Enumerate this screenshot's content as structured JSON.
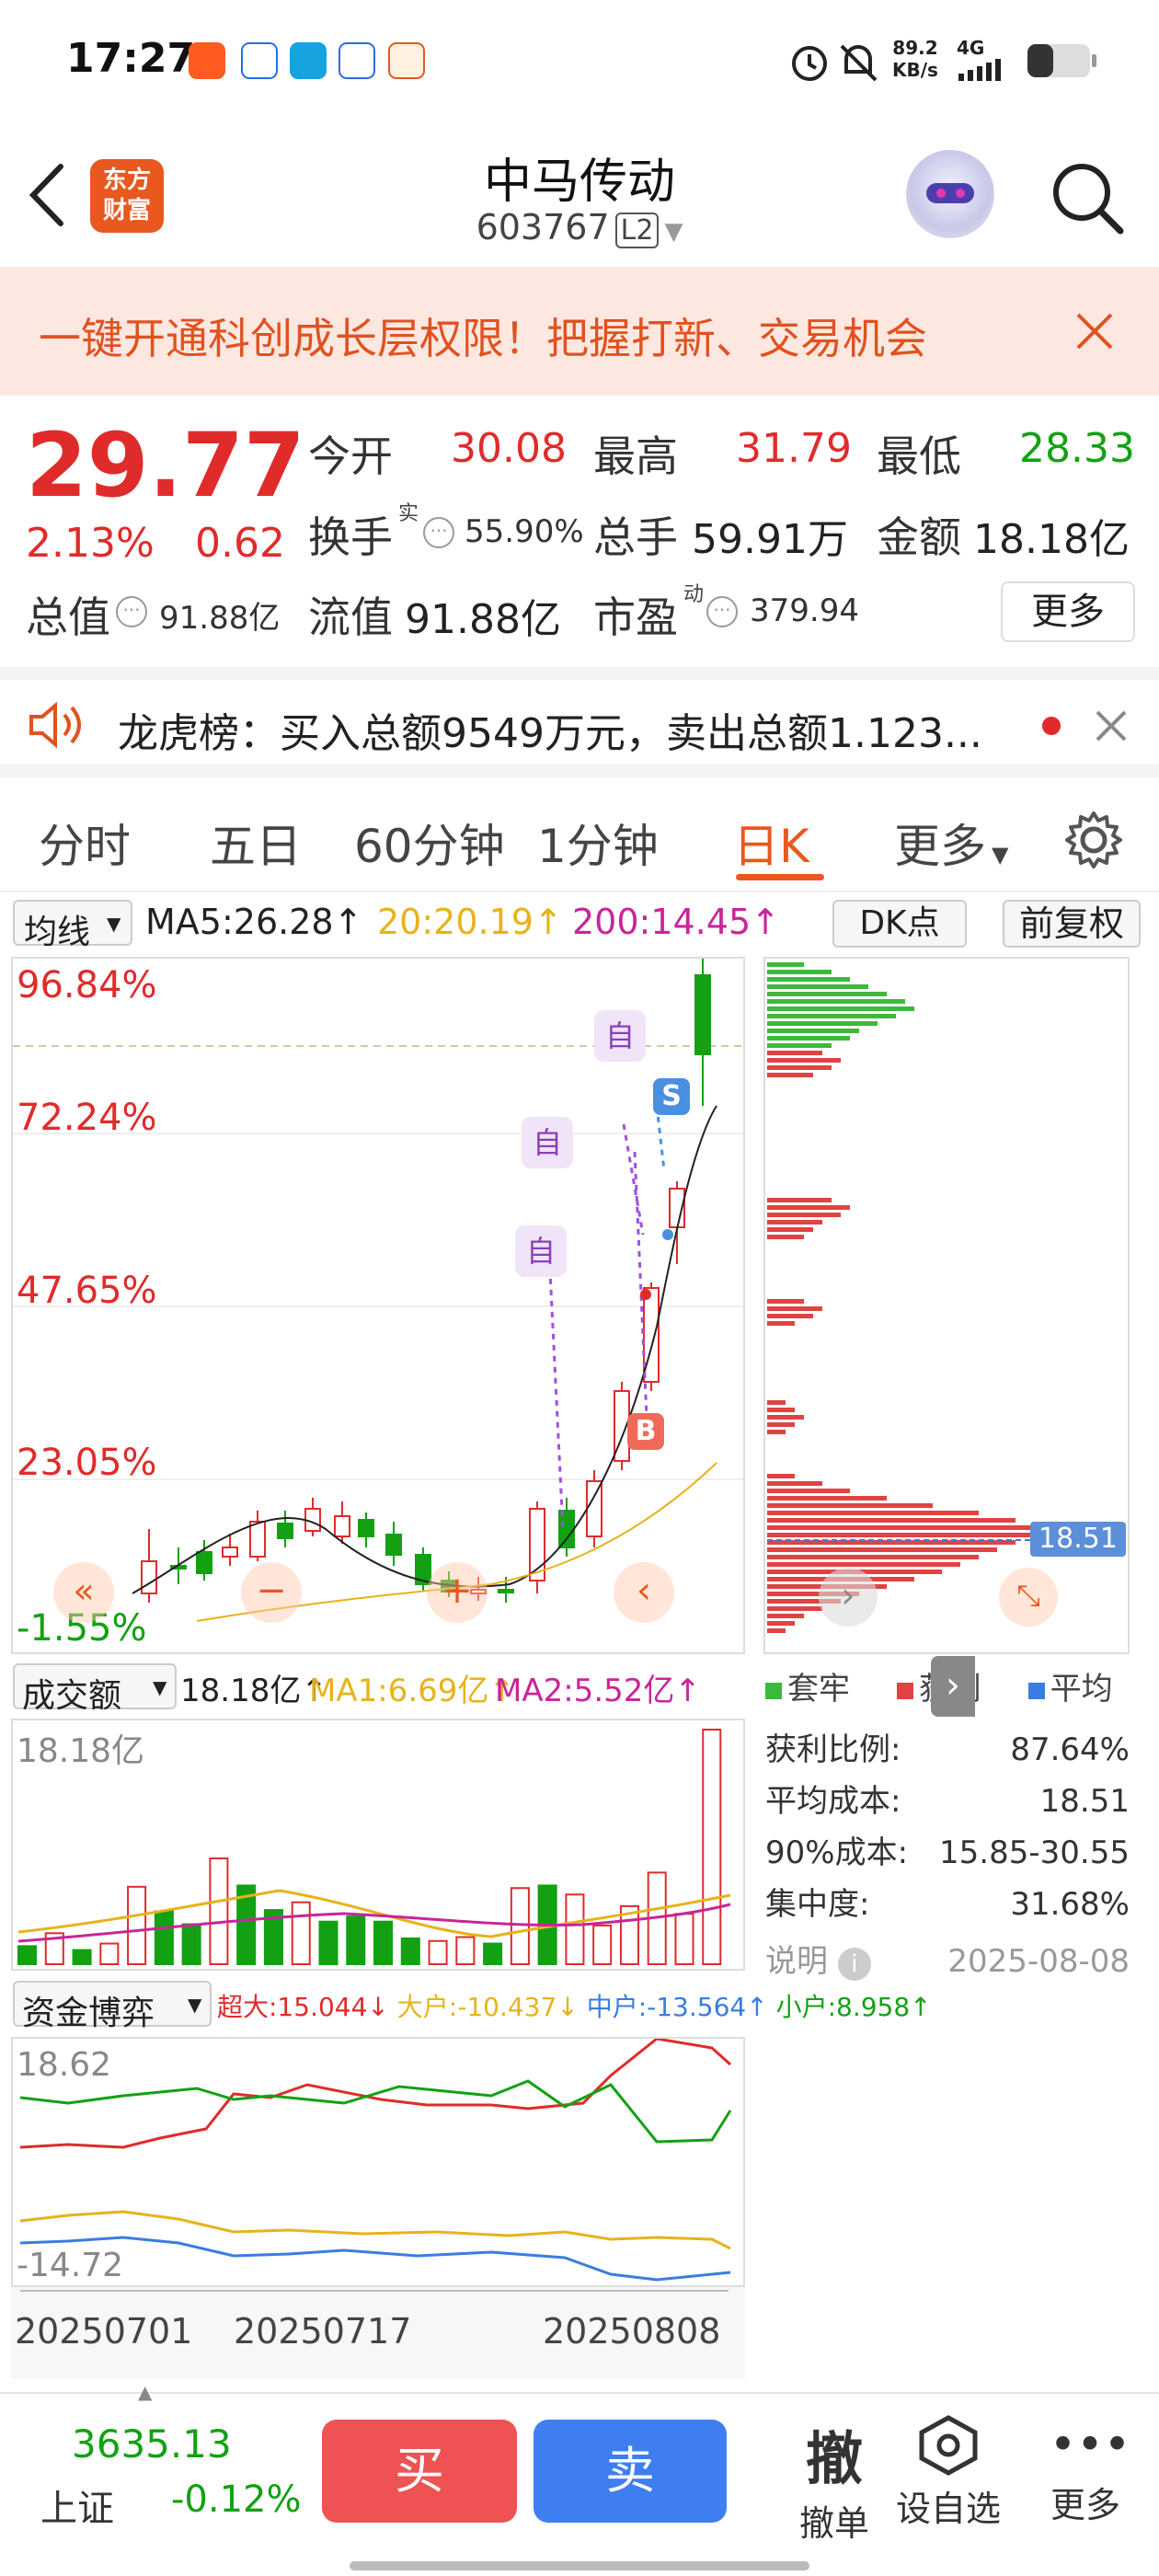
{
  "status_bar": {
    "time": "17:27",
    "net_speed_value": "89.2",
    "net_speed_unit": "KB/s",
    "network": "4G",
    "icons": [
      "app-icon-1",
      "app-icon-2",
      "app-icon-3",
      "app-icon-4",
      "app-icon-5",
      "alarm-icon",
      "mute-icon",
      "signal-icon",
      "battery-icon"
    ]
  },
  "header": {
    "logo_line1": "东方",
    "logo_line2": "财富",
    "stock_name": "中马传动",
    "stock_code": "603767",
    "level_badge": "L2"
  },
  "banner": {
    "text": "一键开通科创成长层权限！把握打新、交易机会"
  },
  "quote": {
    "price": "29.77",
    "change_pct": "2.13%",
    "change": "0.62",
    "open_label": "今开",
    "open": "30.08",
    "high_label": "最高",
    "high": "31.79",
    "low_label": "最低",
    "low": "28.33",
    "turnover_label": "换手",
    "turnover_sup": "实",
    "turnover": "55.90%",
    "volume_label": "总手",
    "volume": "59.91万",
    "amount_label": "金额",
    "amount": "18.18亿",
    "mktcap_label": "总值",
    "mktcap": "91.88亿",
    "float_label": "流值",
    "float": "91.88亿",
    "pe_label": "市盈",
    "pe_sup": "动",
    "pe": "379.94",
    "more_button": "更多"
  },
  "lhb": {
    "text": "龙虎榜：买入总额9549万元，卖出总额1.123..."
  },
  "tabs": {
    "items": [
      "分时",
      "五日",
      "60分钟",
      "1分钟",
      "日K",
      "更多"
    ],
    "active_index": 4
  },
  "kline": {
    "ma_selector": "均线",
    "ma5": "MA5:26.28",
    "ma20": "20:20.19",
    "ma200": "200:14.45",
    "dk_button": "DK点",
    "adjust_button": "前复权",
    "y_labels": [
      "96.84%",
      "72.24%",
      "47.65%",
      "23.05%",
      "-1.55%"
    ],
    "markers": [
      "自",
      "自",
      "自",
      "S",
      "B"
    ],
    "cost_label": "18.51"
  },
  "chip_panel": {
    "legend": [
      "套牢",
      "获利",
      "平均"
    ],
    "legend_colors": [
      "#3cb93c",
      "#e04343",
      "#3a7de0"
    ],
    "rows": [
      {
        "label": "获利比例:",
        "value": "87.64%"
      },
      {
        "label": "平均成本:",
        "value": "18.51"
      },
      {
        "label": "90%成本:",
        "value": "15.85-30.55"
      },
      {
        "label": "集中度:",
        "value": "31.68%"
      }
    ],
    "note_label": "说明",
    "date": "2025-08-08"
  },
  "volume": {
    "selector": "成交额",
    "total": "18.18亿",
    "ma1": "MA1:6.69亿",
    "ma2": "MA2:5.52亿",
    "y_top": "18.18亿",
    "bars": [
      {
        "v": 1.4,
        "up": false
      },
      {
        "v": 2.4,
        "up": true
      },
      {
        "v": 1.1,
        "up": false
      },
      {
        "v": 1.6,
        "up": true
      },
      {
        "v": 6.0,
        "up": true
      },
      {
        "v": 4.1,
        "up": false
      },
      {
        "v": 3.1,
        "up": false
      },
      {
        "v": 8.2,
        "up": true
      },
      {
        "v": 6.1,
        "up": false
      },
      {
        "v": 4.2,
        "up": false
      },
      {
        "v": 4.8,
        "up": true
      },
      {
        "v": 3.3,
        "up": false
      },
      {
        "v": 3.7,
        "up": false
      },
      {
        "v": 3.3,
        "up": false
      },
      {
        "v": 2.0,
        "up": false
      },
      {
        "v": 1.8,
        "up": true
      },
      {
        "v": 2.1,
        "up": true
      },
      {
        "v": 1.6,
        "up": false
      },
      {
        "v": 5.9,
        "up": true
      },
      {
        "v": 6.1,
        "up": false
      },
      {
        "v": 5.4,
        "up": true
      },
      {
        "v": 3.0,
        "up": true
      },
      {
        "v": 4.5,
        "up": true
      },
      {
        "v": 7.1,
        "up": true
      },
      {
        "v": 3.9,
        "up": true
      },
      {
        "v": 18.18,
        "up": true
      }
    ]
  },
  "fund": {
    "selector": "资金博弈",
    "super": "超大:15.044",
    "large": "大户:-10.437",
    "mid": "中户:-13.564",
    "small": "小户:8.958",
    "y_top": "18.62",
    "y_bottom": "-14.72",
    "dates": [
      "20250701",
      "20250717",
      "20250808"
    ]
  },
  "bottom": {
    "index_value": "3635.13",
    "index_name": "上证",
    "index_change": "-0.12%",
    "buy": "买",
    "sell": "卖",
    "cancel_glyph": "撤",
    "cancel_label": "撤单",
    "watchlist_label": "设自选",
    "more_label": "更多"
  }
}
